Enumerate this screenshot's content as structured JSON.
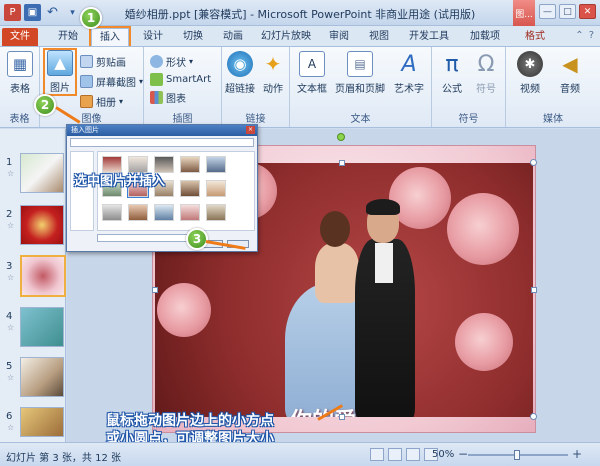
{
  "window": {
    "title": "婚纱相册.ppt [兼容模式] - Microsoft PowerPoint 非商业用途 (试用版)",
    "context_group": "图...",
    "min": "—",
    "max": "□",
    "close": "✕"
  },
  "tabs": [
    {
      "label": "文件"
    },
    {
      "label": "开始"
    },
    {
      "label": "插入"
    },
    {
      "label": "设计"
    },
    {
      "label": "切换"
    },
    {
      "label": "动画"
    },
    {
      "label": "幻灯片放映"
    },
    {
      "label": "审阅"
    },
    {
      "label": "视图"
    },
    {
      "label": "开发工具"
    },
    {
      "label": "加载项"
    },
    {
      "label": "格式"
    }
  ],
  "ribbon": {
    "table": {
      "button": "表格",
      "group": "表格"
    },
    "images": {
      "picture": "图片",
      "clipart": "剪贴画",
      "screenshot": "屏幕截图",
      "album": "相册",
      "group": "图像"
    },
    "illustrations": {
      "shapes": "形状",
      "smartart": "SmartArt",
      "chart": "图表",
      "group": "插图"
    },
    "links": {
      "hyperlink": "超链接",
      "action": "动作",
      "group": "链接"
    },
    "text": {
      "textbox": "文本框",
      "headerfooter": "页眉和页脚",
      "wordart": "艺术字",
      "group": "文本"
    },
    "symbols": {
      "equation": "公式",
      "symbol": "符号",
      "group": "符号"
    },
    "media": {
      "video": "视频",
      "audio": "音频",
      "group": "媒体"
    }
  },
  "thumbnails": [
    {
      "num": "1"
    },
    {
      "num": "2"
    },
    {
      "num": "3"
    },
    {
      "num": "4"
    },
    {
      "num": "5"
    },
    {
      "num": "6"
    }
  ],
  "dialog": {
    "title": "插入图片"
  },
  "annotations": {
    "step1": "1",
    "step2": "2",
    "step3": "3",
    "select_tip": "选中图片并插入",
    "resize_tip_line1": "鼠标拖动图片边上的小方点",
    "resize_tip_line2": "或小圆点，可调整图片大小"
  },
  "slide": {
    "text": "你的爱"
  },
  "status": {
    "slide_info": "幻灯片 第 3 张，共 12 张",
    "zoom": "50%"
  },
  "colors": {
    "file_tab": "#d24726",
    "highlight": "#f08a2a",
    "badge": "#3f8f1f",
    "callout_stroke": "#1a52a7"
  }
}
